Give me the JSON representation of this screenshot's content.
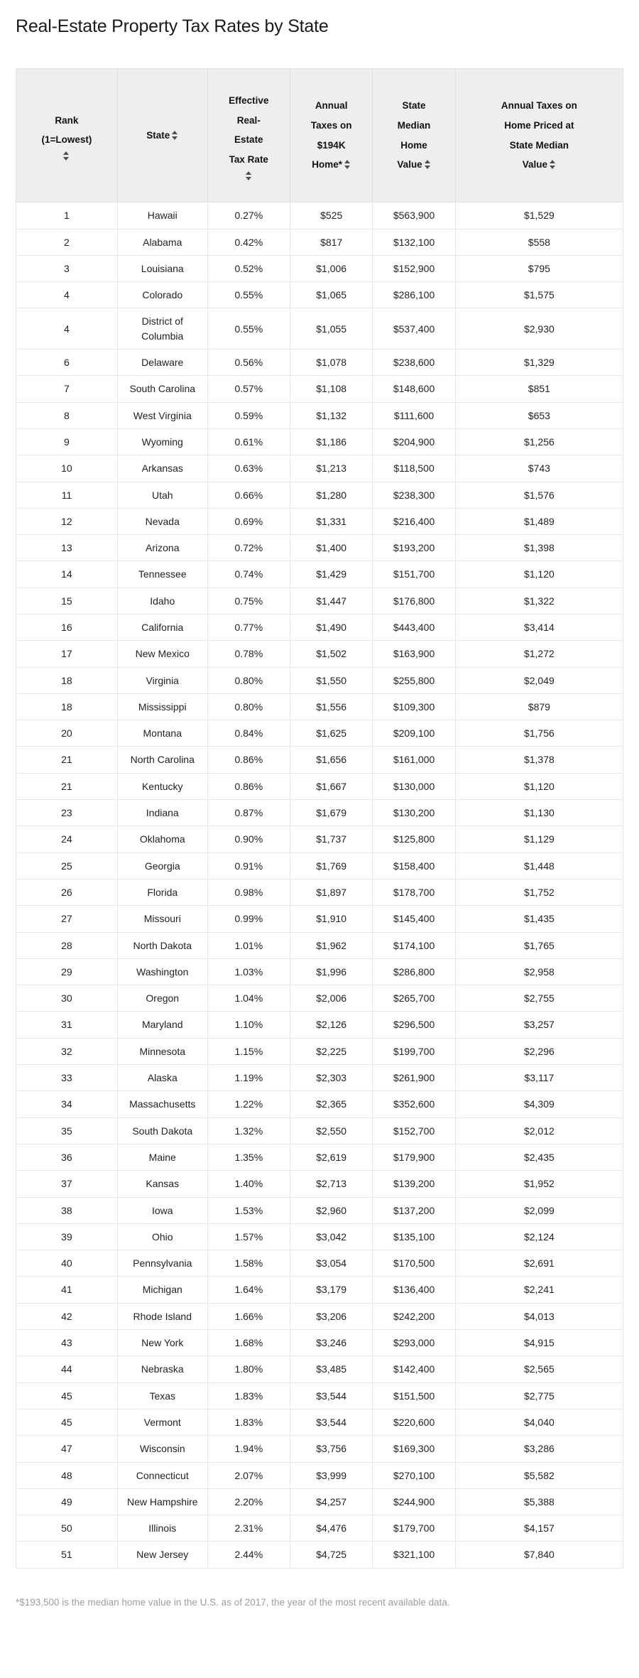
{
  "page": {
    "title": "Real-Estate Property Tax Rates by State"
  },
  "table": {
    "sort_icon": "sort-updown-icon",
    "columns": [
      {
        "id": "rank",
        "label_line1": "Rank",
        "label_line2": "(1=Lowest)",
        "sortable": true
      },
      {
        "id": "state",
        "label_line1": "State",
        "label_line2": "",
        "sortable": true
      },
      {
        "id": "rate",
        "label_line1": "Effective",
        "label_line2": "Real-",
        "label_line3": "Estate",
        "label_line4": "Tax Rate",
        "sortable": true
      },
      {
        "id": "tax194",
        "label_line1": "Annual",
        "label_line2": "Taxes on",
        "label_line3": "$194K",
        "label_line4": "Home*",
        "sortable": true
      },
      {
        "id": "median",
        "label_line1": "State",
        "label_line2": "Median",
        "label_line3": "Home",
        "label_line4": "Value",
        "sortable": true
      },
      {
        "id": "taxmed",
        "label_line1": "Annual Taxes on",
        "label_line2": "Home Priced at",
        "label_line3": "State Median",
        "label_line4": "Value",
        "sortable": true
      }
    ],
    "rows": [
      [
        "1",
        "Hawaii",
        "0.27%",
        "$525",
        "$563,900",
        "$1,529"
      ],
      [
        "2",
        "Alabama",
        "0.42%",
        "$817",
        "$132,100",
        "$558"
      ],
      [
        "3",
        "Louisiana",
        "0.52%",
        "$1,006",
        "$152,900",
        "$795"
      ],
      [
        "4",
        "Colorado",
        "0.55%",
        "$1,065",
        "$286,100",
        "$1,575"
      ],
      [
        "4",
        "District of Columbia",
        "0.55%",
        "$1,055",
        "$537,400",
        "$2,930"
      ],
      [
        "6",
        "Delaware",
        "0.56%",
        "$1,078",
        "$238,600",
        "$1,329"
      ],
      [
        "7",
        "South Carolina",
        "0.57%",
        "$1,108",
        "$148,600",
        "$851"
      ],
      [
        "8",
        "West Virginia",
        "0.59%",
        "$1,132",
        "$111,600",
        "$653"
      ],
      [
        "9",
        "Wyoming",
        "0.61%",
        "$1,186",
        "$204,900",
        "$1,256"
      ],
      [
        "10",
        "Arkansas",
        "0.63%",
        "$1,213",
        "$118,500",
        "$743"
      ],
      [
        "11",
        "Utah",
        "0.66%",
        "$1,280",
        "$238,300",
        "$1,576"
      ],
      [
        "12",
        "Nevada",
        "0.69%",
        "$1,331",
        "$216,400",
        "$1,489"
      ],
      [
        "13",
        "Arizona",
        "0.72%",
        "$1,400",
        "$193,200",
        "$1,398"
      ],
      [
        "14",
        "Tennessee",
        "0.74%",
        "$1,429",
        "$151,700",
        "$1,120"
      ],
      [
        "15",
        "Idaho",
        "0.75%",
        "$1,447",
        "$176,800",
        "$1,322"
      ],
      [
        "16",
        "California",
        "0.77%",
        "$1,490",
        "$443,400",
        "$3,414"
      ],
      [
        "17",
        "New Mexico",
        "0.78%",
        "$1,502",
        "$163,900",
        "$1,272"
      ],
      [
        "18",
        "Virginia",
        "0.80%",
        "$1,550",
        "$255,800",
        "$2,049"
      ],
      [
        "18",
        "Mississippi",
        "0.80%",
        "$1,556",
        "$109,300",
        "$879"
      ],
      [
        "20",
        "Montana",
        "0.84%",
        "$1,625",
        "$209,100",
        "$1,756"
      ],
      [
        "21",
        "North Carolina",
        "0.86%",
        "$1,656",
        "$161,000",
        "$1,378"
      ],
      [
        "21",
        "Kentucky",
        "0.86%",
        "$1,667",
        "$130,000",
        "$1,120"
      ],
      [
        "23",
        "Indiana",
        "0.87%",
        "$1,679",
        "$130,200",
        "$1,130"
      ],
      [
        "24",
        "Oklahoma",
        "0.90%",
        "$1,737",
        "$125,800",
        "$1,129"
      ],
      [
        "25",
        "Georgia",
        "0.91%",
        "$1,769",
        "$158,400",
        "$1,448"
      ],
      [
        "26",
        "Florida",
        "0.98%",
        "$1,897",
        "$178,700",
        "$1,752"
      ],
      [
        "27",
        "Missouri",
        "0.99%",
        "$1,910",
        "$145,400",
        "$1,435"
      ],
      [
        "28",
        "North Dakota",
        "1.01%",
        "$1,962",
        "$174,100",
        "$1,765"
      ],
      [
        "29",
        "Washington",
        "1.03%",
        "$1,996",
        "$286,800",
        "$2,958"
      ],
      [
        "30",
        "Oregon",
        "1.04%",
        "$2,006",
        "$265,700",
        "$2,755"
      ],
      [
        "31",
        "Maryland",
        "1.10%",
        "$2,126",
        "$296,500",
        "$3,257"
      ],
      [
        "32",
        "Minnesota",
        "1.15%",
        "$2,225",
        "$199,700",
        "$2,296"
      ],
      [
        "33",
        "Alaska",
        "1.19%",
        "$2,303",
        "$261,900",
        "$3,117"
      ],
      [
        "34",
        "Massachusetts",
        "1.22%",
        "$2,365",
        "$352,600",
        "$4,309"
      ],
      [
        "35",
        "South Dakota",
        "1.32%",
        "$2,550",
        "$152,700",
        "$2,012"
      ],
      [
        "36",
        "Maine",
        "1.35%",
        "$2,619",
        "$179,900",
        "$2,435"
      ],
      [
        "37",
        "Kansas",
        "1.40%",
        "$2,713",
        "$139,200",
        "$1,952"
      ],
      [
        "38",
        "Iowa",
        "1.53%",
        "$2,960",
        "$137,200",
        "$2,099"
      ],
      [
        "39",
        "Ohio",
        "1.57%",
        "$3,042",
        "$135,100",
        "$2,124"
      ],
      [
        "40",
        "Pennsylvania",
        "1.58%",
        "$3,054",
        "$170,500",
        "$2,691"
      ],
      [
        "41",
        "Michigan",
        "1.64%",
        "$3,179",
        "$136,400",
        "$2,241"
      ],
      [
        "42",
        "Rhode Island",
        "1.66%",
        "$3,206",
        "$242,200",
        "$4,013"
      ],
      [
        "43",
        "New York",
        "1.68%",
        "$3,246",
        "$293,000",
        "$4,915"
      ],
      [
        "44",
        "Nebraska",
        "1.80%",
        "$3,485",
        "$142,400",
        "$2,565"
      ],
      [
        "45",
        "Texas",
        "1.83%",
        "$3,544",
        "$151,500",
        "$2,775"
      ],
      [
        "45",
        "Vermont",
        "1.83%",
        "$3,544",
        "$220,600",
        "$4,040"
      ],
      [
        "47",
        "Wisconsin",
        "1.94%",
        "$3,756",
        "$169,300",
        "$3,286"
      ],
      [
        "48",
        "Connecticut",
        "2.07%",
        "$3,999",
        "$270,100",
        "$5,582"
      ],
      [
        "49",
        "New Hampshire",
        "2.20%",
        "$4,257",
        "$244,900",
        "$5,388"
      ],
      [
        "50",
        "Illinois",
        "2.31%",
        "$4,476",
        "$179,700",
        "$4,157"
      ],
      [
        "51",
        "New Jersey",
        "2.44%",
        "$4,725",
        "$321,100",
        "$7,840"
      ]
    ]
  },
  "footnote": {
    "text": "*$193,500 is the median home value in the U.S. as of 2017, the year of the most recent available data."
  },
  "colors": {
    "header_bg": "#edeef0",
    "border": "#e6e7ea",
    "text": "#222222",
    "footnote_text": "#9b9ea3"
  }
}
